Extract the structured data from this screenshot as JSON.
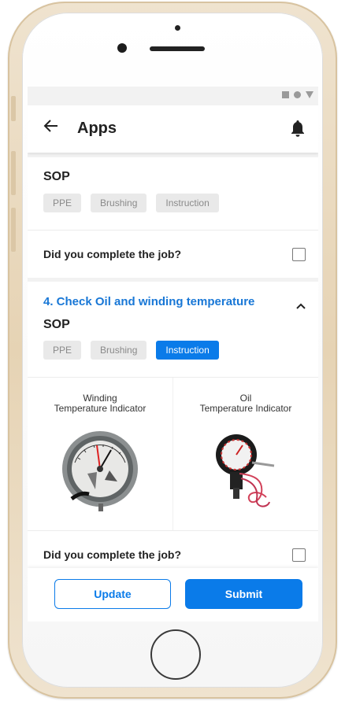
{
  "app": {
    "title": "Apps"
  },
  "status_icons": [
    "square-icon",
    "circle-icon",
    "triangle-icon"
  ],
  "section_prev": {
    "sop_label": "SOP",
    "chips": [
      "PPE",
      "Brushing",
      "Instruction"
    ],
    "question": "Did you complete the job?"
  },
  "section_current": {
    "title": "4. Check Oil and winding temperature",
    "sop_label": "SOP",
    "chips": [
      "PPE",
      "Brushing",
      "Instruction"
    ],
    "active_chip": "Instruction",
    "instruments": [
      {
        "caption_line1": "Winding",
        "caption_line2": "Temperature Indicator"
      },
      {
        "caption_line1": "Oil",
        "caption_line2": "Temperature Indicator"
      }
    ],
    "question": "Did you complete the job?"
  },
  "actions": {
    "update_label": "Update",
    "submit_label": "Submit"
  },
  "colors": {
    "accent": "#0a7be9",
    "title_blue": "#1877d6",
    "chip_bg": "#e9e9e9"
  }
}
